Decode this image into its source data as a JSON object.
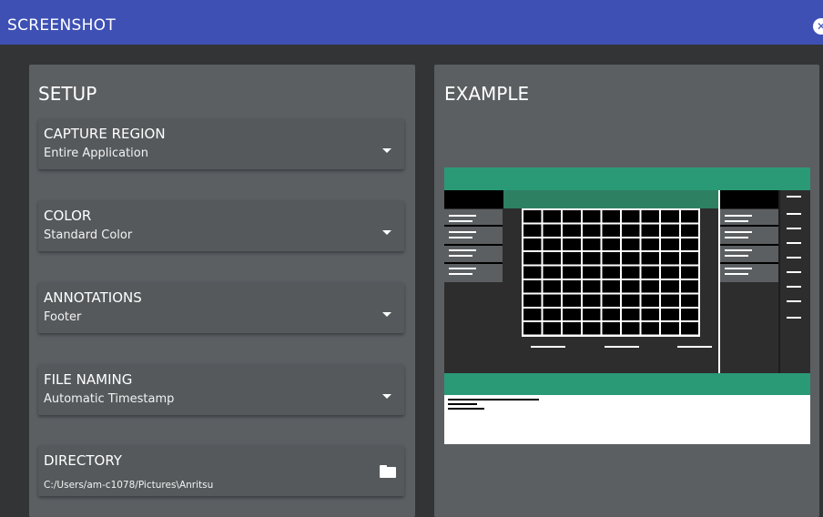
{
  "window": {
    "title": "SCREENSHOT",
    "close_icon": "close-icon"
  },
  "setup": {
    "title": "SETUP",
    "fields": [
      {
        "label": "CAPTURE REGION",
        "value": "Entire Application",
        "icon": "chevron-down-icon"
      },
      {
        "label": "COLOR",
        "value": "Standard Color",
        "icon": "chevron-down-icon"
      },
      {
        "label": "ANNOTATIONS",
        "value": "Footer",
        "icon": "chevron-down-icon"
      },
      {
        "label": "FILE NAMING",
        "value": "Automatic Timestamp",
        "icon": "chevron-down-icon"
      },
      {
        "label": "DIRECTORY",
        "value": "C:/Users/am-c1078/Pictures\\Anritsu",
        "icon": "folder-icon"
      }
    ]
  },
  "example": {
    "title": "EXAMPLE"
  },
  "colors": {
    "titlebar": "#3e50b4",
    "panel": "#5b5f62",
    "field": "#55595c",
    "accent": "#2a9a76",
    "background": "#333435"
  }
}
